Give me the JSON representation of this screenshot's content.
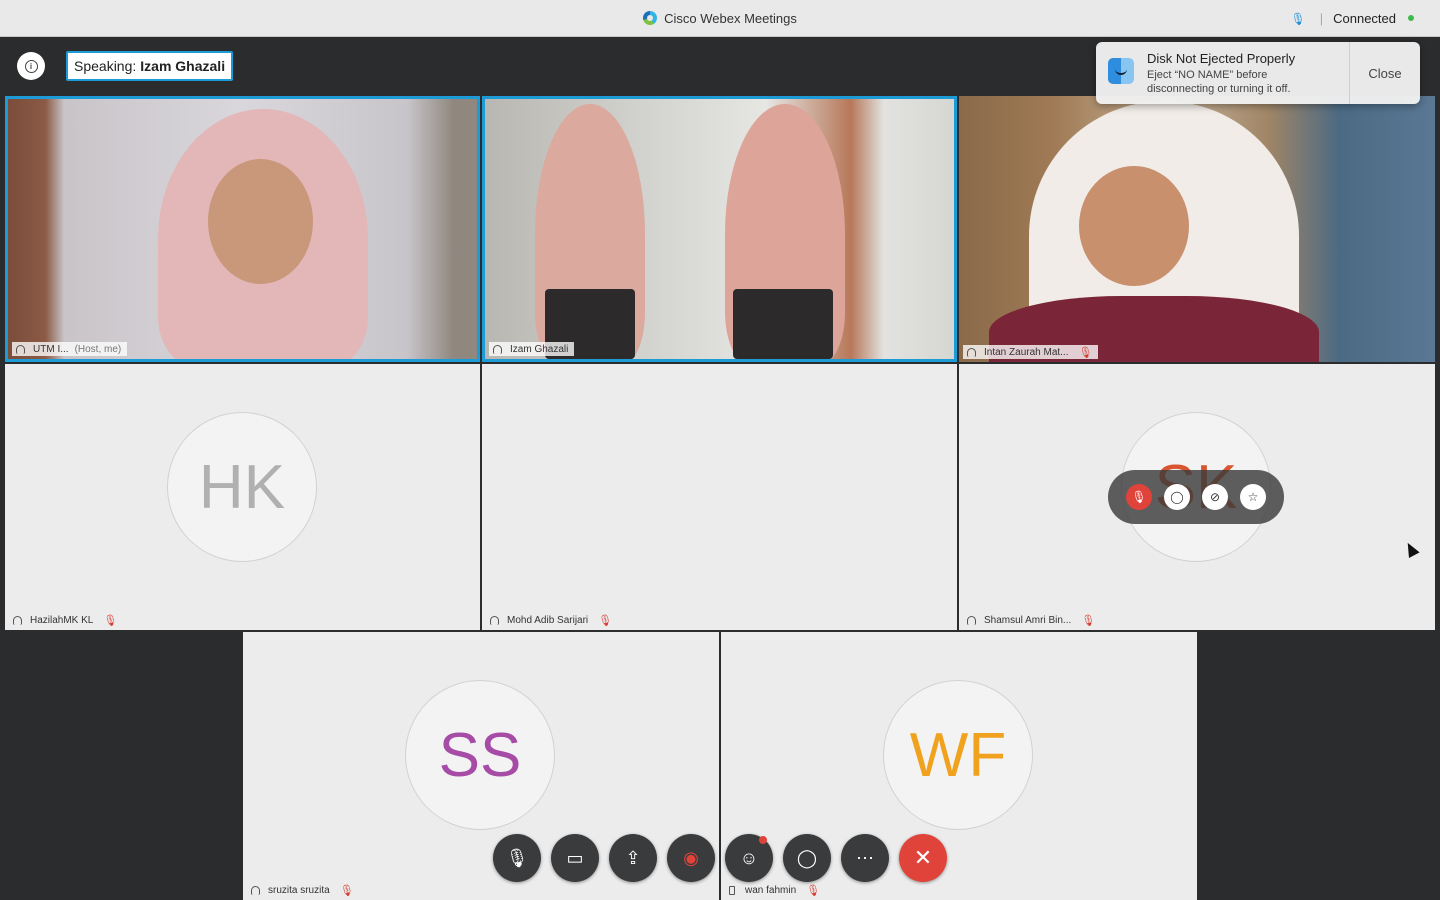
{
  "window": {
    "title": "Cisco Webex Meetings",
    "status": "Connected"
  },
  "speaking": {
    "label": "Speaking:",
    "name": "Izam Ghazali"
  },
  "notification": {
    "title": "Disk Not Ejected Properly",
    "body": "Eject “NO NAME” before disconnecting or turning it off.",
    "close_label": "Close"
  },
  "participants": [
    {
      "name": "UTM I...",
      "tag": "(Host, me)",
      "video": true,
      "active": true
    },
    {
      "name": "Izam Ghazali",
      "video": true,
      "active": true
    },
    {
      "name": "Intan Zaurah Mat...",
      "video": true,
      "muted": true
    },
    {
      "name": "HazilahMK KL",
      "initials": "HK",
      "initials_color": "#b0b0b0",
      "muted": true
    },
    {
      "name": "Mohd Adib Sarijari",
      "muted": true
    },
    {
      "name": "Shamsul Amri Bin...",
      "initials": "SK",
      "initials_color": "#d8552f",
      "muted": true
    },
    {
      "name": "sruzita sruzita",
      "initials": "SS",
      "initials_color": "#a64ca6",
      "muted": true
    },
    {
      "name": "wan fahmin",
      "initials": "WF",
      "initials_color": "#f0a21e",
      "muted": true,
      "device": "phone"
    }
  ],
  "hover_actions": [
    "mute-icon",
    "chat-icon",
    "block-icon",
    "pin-icon"
  ],
  "controls": [
    {
      "name": "mute-icon"
    },
    {
      "name": "video-off-icon"
    },
    {
      "name": "share-icon"
    },
    {
      "name": "record-icon"
    },
    {
      "name": "participants-icon",
      "badge": true
    },
    {
      "name": "chat-icon"
    },
    {
      "name": "more-icon"
    },
    {
      "name": "leave-icon"
    }
  ]
}
